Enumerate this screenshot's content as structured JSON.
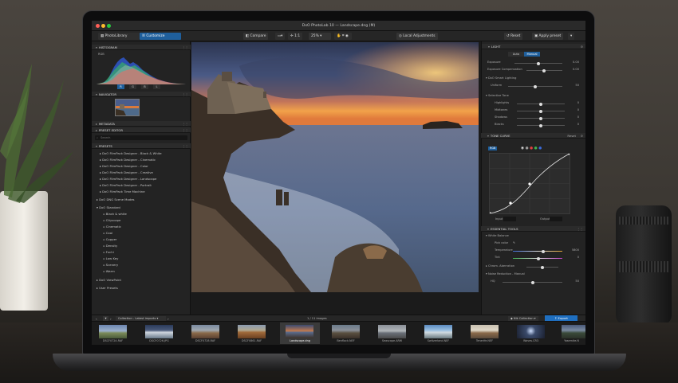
{
  "window": {
    "title": "DxO PhotoLab 10 — Landscape.dng (M)"
  },
  "toolbar": {
    "photolibrary": "PhotoLibrary",
    "customize": "Customize",
    "compare": "Compare",
    "fit": "1:1",
    "zoom": "25%",
    "local_adjustments": "Local Adjustments",
    "reset": "Reset",
    "apply_preset": "Apply preset"
  },
  "left": {
    "histogram": "HISTOGRAM",
    "hist_mode": "RGB",
    "channels": [
      "R",
      "G",
      "B",
      "L"
    ],
    "navigator": "NAVIGATOR",
    "metadata": "METADATA",
    "preset_editor": "PRESET EDITOR",
    "search_placeholder": "Search",
    "presets": "PRESETS",
    "filmpack": [
      "DxO FilmPack Designer - Black & White",
      "DxO FilmPack Designer - Cinematic",
      "DxO FilmPack Designer - Color",
      "DxO FilmPack Designer - Creative",
      "DxO FilmPack Designer - Landscape",
      "DxO FilmPack Designer - Portrait",
      "DxO FilmPack Time Machine"
    ],
    "dng_modes": "DxO DNG Scene Modes",
    "standard": "DxO Standard",
    "standard_items": [
      "Black & white",
      "Cityscape",
      "Cinematic",
      "Cool",
      "Copper",
      "Density",
      "Fuchi",
      "Low Key",
      "Scenery",
      "Warm"
    ],
    "viewpoint": "DxO ViewPoint",
    "user_presets": "User Presets"
  },
  "right": {
    "light": "LIGHT",
    "auto": "Auto",
    "manual": "Manual",
    "exposure": "Exposure",
    "exposure_val": "0.00",
    "exp_comp": "Exposure Compensation",
    "exp_comp_val": "0.00",
    "smart_lighting": "DxO Smart Lighting",
    "uniform": "Uniform",
    "uniform_val": "50",
    "selective_tone": "Selective Tone",
    "tones": [
      {
        "label": "Highlights",
        "val": "0"
      },
      {
        "label": "Midtones",
        "val": "0"
      },
      {
        "label": "Shadows",
        "val": "0"
      },
      {
        "label": "Blacks",
        "val": "0"
      }
    ],
    "tone_curve": "TONE CURVE",
    "reset": "Reset",
    "rgb": "RGB",
    "input_label": "Input",
    "output_label": "Output",
    "essential": "ESSENTIAL TOOLS",
    "white_balance": "White Balance",
    "pick_color": "Pick color",
    "temperature": "Temperature",
    "temperature_val": "5800",
    "tint": "Tint",
    "tint_val": "0",
    "chrom_ab": "Chrom. Aberration",
    "noise": "Noise Reduction - Manual",
    "hq": "HQ",
    "hq_val": "50"
  },
  "filmbar": {
    "collection": "Collection - Latest imports",
    "count": "1 / 11 images",
    "nik": "Nik Collection",
    "export": "Export"
  },
  "filmstrip": [
    "DSCF0724.RAF",
    "DSCF0726.JPG",
    "DSCF0728.RAF",
    "DSCF0861.RAF",
    "Landscape.dng",
    "Benflock.NEF",
    "Seascape.ARW",
    "Switzerland.NEF",
    "Tenerife.NEF",
    "Waves.CR3",
    "Yosemite.N"
  ],
  "colors": {
    "accent": "#1f5f9c",
    "panel": "#232323",
    "header": "#2b2b2b"
  }
}
